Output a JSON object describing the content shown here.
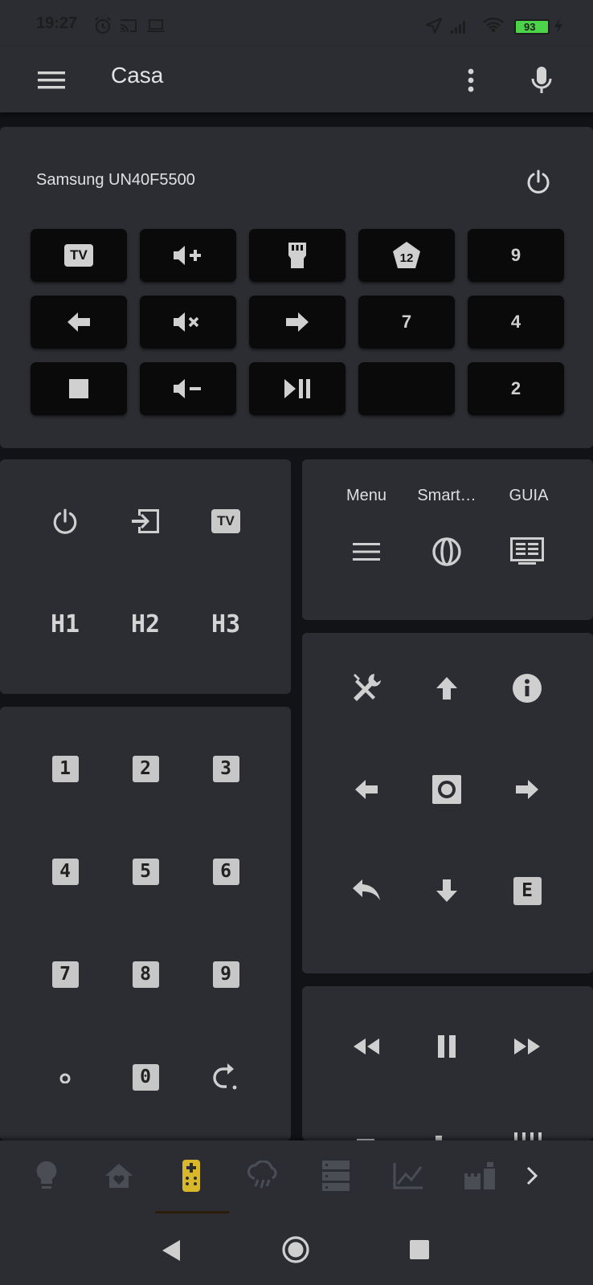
{
  "status": {
    "time": "19:27",
    "battery": "93"
  },
  "app_bar": {
    "title": "Casa"
  },
  "tv_card": {
    "title": "Samsung UN40F5500",
    "rows": [
      [
        "TV",
        "vol+",
        "hdmi",
        "12",
        "9"
      ],
      [
        "left",
        "mute",
        "right",
        "7",
        "4"
      ],
      [
        "stop",
        "vol-",
        "play-pause",
        "",
        "2"
      ]
    ],
    "pad_labels": {
      "channel_a": "12",
      "num_9": "9",
      "num_7": "7",
      "num_4": "4",
      "num_2": "2",
      "tv": "TV"
    }
  },
  "power_card": {
    "hdmi1": "H1",
    "hdmi2": "H2",
    "hdmi3": "H3",
    "tv_badge": "TV"
  },
  "menu_card": {
    "menu": "Menu",
    "smart": "Smart…",
    "guide": "GUIA"
  },
  "numpad": {
    "keys": [
      "1",
      "2",
      "3",
      "4",
      "5",
      "6",
      "7",
      "8",
      "9",
      "0"
    ]
  },
  "dpad_card": {
    "exit": "E"
  },
  "colors": {
    "accent": "#d8b82a",
    "card": "#2b2d33",
    "background": "#111316",
    "pad": "#0a0a0a"
  }
}
